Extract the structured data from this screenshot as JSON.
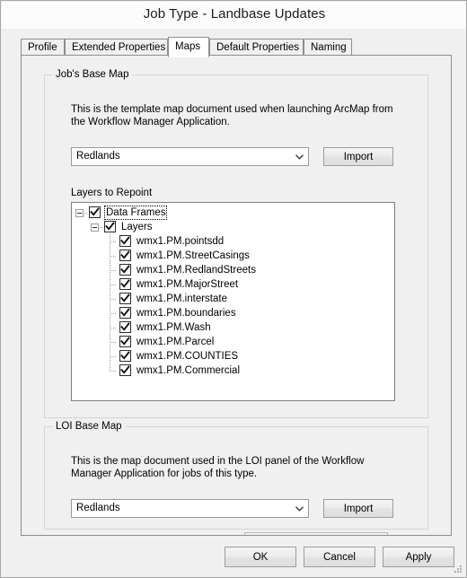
{
  "window": {
    "title": "Job Type - Landbase Updates"
  },
  "tabs": [
    {
      "label": "Profile",
      "active": false
    },
    {
      "label": "Extended Properties",
      "active": false
    },
    {
      "label": "Maps",
      "active": true
    },
    {
      "label": "Default Properties",
      "active": false
    },
    {
      "label": "Naming",
      "active": false
    }
  ],
  "job_base_map": {
    "legend": "Job's Base Map",
    "description": "This is the template map document used when launching ArcMap from\nthe Workflow Manager Application.",
    "combo_value": "Redlands",
    "import_label": "Import",
    "dropdown_icon": "chevron-down-icon"
  },
  "layers_to_repoint": {
    "label": "Layers to Repoint",
    "tree": [
      {
        "label": "Data Frames",
        "depth": 0,
        "checked": true,
        "expander": "minus",
        "focused": true
      },
      {
        "label": "Layers",
        "depth": 1,
        "checked": true,
        "expander": "minus",
        "focused": false
      },
      {
        "label": "wmx1.PM.pointsdd",
        "depth": 2,
        "checked": true,
        "expander": "none",
        "focused": false
      },
      {
        "label": "wmx1.PM.StreetCasings",
        "depth": 2,
        "checked": true,
        "expander": "none",
        "focused": false
      },
      {
        "label": "wmx1.PM.RedlandStreets",
        "depth": 2,
        "checked": true,
        "expander": "none",
        "focused": false
      },
      {
        "label": "wmx1.PM.MajorStreet",
        "depth": 2,
        "checked": true,
        "expander": "none",
        "focused": false
      },
      {
        "label": "wmx1.PM.interstate",
        "depth": 2,
        "checked": true,
        "expander": "none",
        "focused": false
      },
      {
        "label": "wmx1.PM.boundaries",
        "depth": 2,
        "checked": true,
        "expander": "none",
        "focused": false
      },
      {
        "label": "wmx1.PM.Wash",
        "depth": 2,
        "checked": true,
        "expander": "none",
        "focused": false
      },
      {
        "label": "wmx1.PM.Parcel",
        "depth": 2,
        "checked": true,
        "expander": "none",
        "focused": false
      },
      {
        "label": "wmx1.PM.COUNTIES",
        "depth": 2,
        "checked": true,
        "expander": "none",
        "focused": false
      },
      {
        "label": "wmx1.PM.Commercial",
        "depth": 2,
        "checked": true,
        "expander": "none",
        "focused": false
      }
    ]
  },
  "loi_base_map": {
    "legend": "LOI Base Map",
    "description": "This is the map document used in the LOI panel of the Workflow\nManager Application for jobs of this type.",
    "combo_value": "Redlands",
    "import_label": "Import",
    "dropdown_icon": "chevron-down-icon"
  },
  "footer": {
    "ok_label": "OK",
    "cancel_label": "Cancel",
    "apply_label": "Apply",
    "resize_grip_icon": "resize-grip-icon"
  },
  "colors": {
    "window_bg": "#f0f0f0",
    "titlebar_bg": "#fcfcfc",
    "panel_bg": "#ffffff",
    "border": "#8e8e8e",
    "group_border": "#d4d4d4",
    "tree_border": "#7c8189"
  }
}
